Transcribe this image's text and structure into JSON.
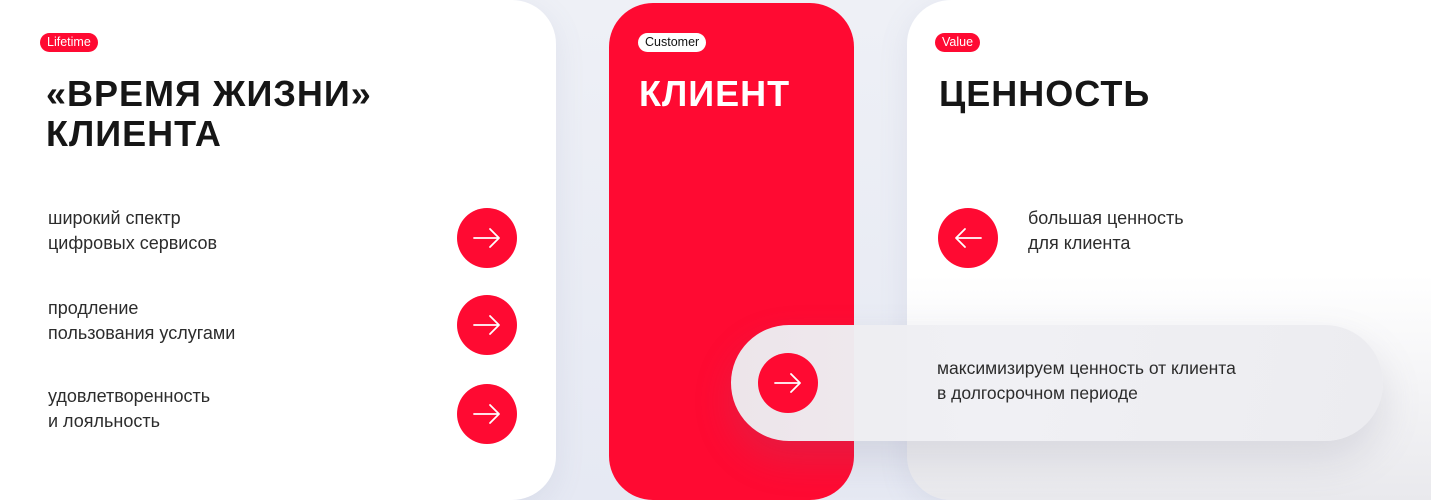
{
  "lifetime": {
    "tag": "Lifetime",
    "title_line1": "«ВРЕМЯ ЖИЗНИ»",
    "title_line2": "КЛИЕНТА",
    "items": [
      {
        "line1": "широкий спектр",
        "line2": "цифровых сервисов"
      },
      {
        "line1": "продление",
        "line2": "пользования услугами"
      },
      {
        "line1": "удовлетворенность",
        "line2": "и лояльность"
      }
    ]
  },
  "customer": {
    "tag": "Customer",
    "title": "КЛИЕНТ"
  },
  "value": {
    "tag": "Value",
    "title": "ЦЕННОСТЬ",
    "item": {
      "line1": "большая ценность",
      "line2": "для клиента"
    }
  },
  "summary": {
    "line1": "максимизируем ценность от клиента",
    "line2": "в долгосрочном периоде"
  },
  "icons": {
    "arrow_right": "arrow-right-icon",
    "arrow_left": "arrow-left-icon"
  },
  "colors": {
    "accent": "#ff0a32",
    "card": "#ffffff",
    "background": "#e9ecf4"
  }
}
